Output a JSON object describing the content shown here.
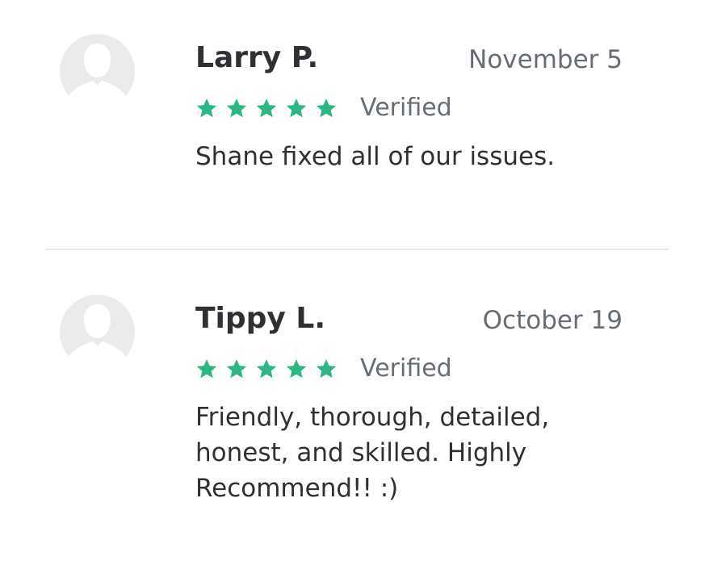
{
  "colors": {
    "star": "#2db783",
    "name_text": "#2f3033",
    "muted_text": "#676d73",
    "avatar_bg": "#ebebeb",
    "divider": "#e6e7e8"
  },
  "reviews": [
    {
      "avatar_icon": "person-silhouette-icon",
      "name": "Larry P.",
      "date": "November 5",
      "rating": 5,
      "rating_max": 5,
      "star_icon": "star-icon",
      "verified_label": "Verified",
      "text": "Shane fixed all of our issues."
    },
    {
      "avatar_icon": "person-silhouette-icon",
      "name": "Tippy L.",
      "date": "October 19",
      "rating": 5,
      "rating_max": 5,
      "star_icon": "star-icon",
      "verified_label": "Verified",
      "text": "Friendly, thorough, detailed, honest, and skilled. Highly Recommend!! :)"
    }
  ]
}
